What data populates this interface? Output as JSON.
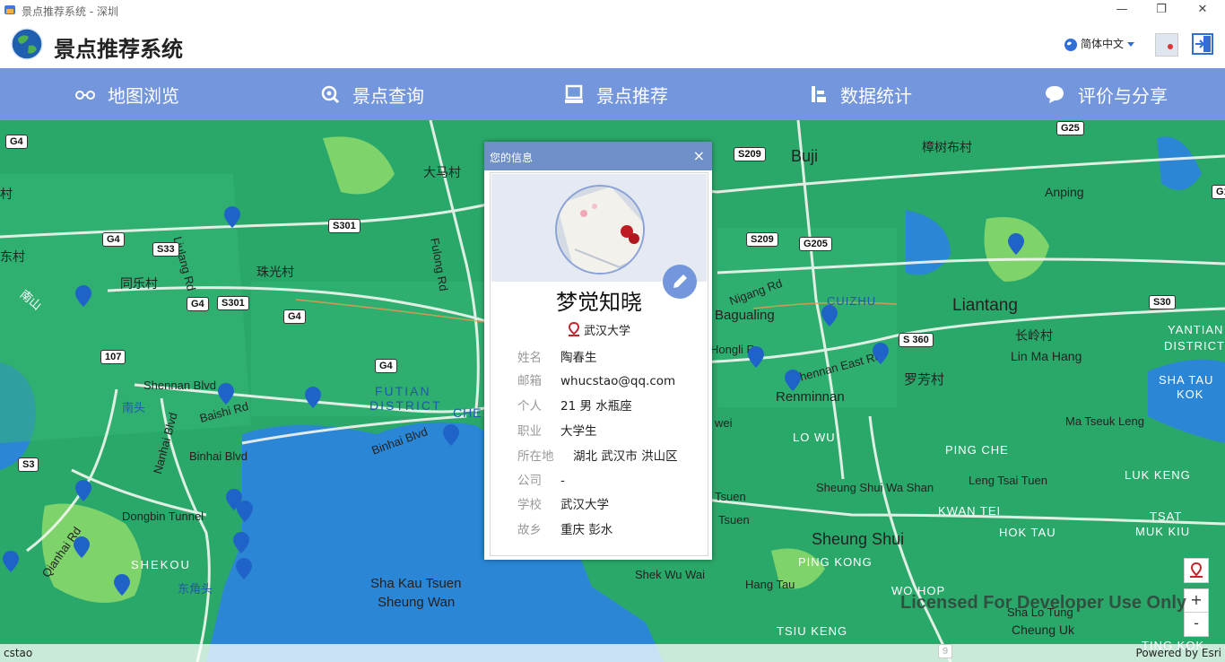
{
  "window": {
    "title": "景点推荐系统 - 深圳",
    "minimize": "—",
    "maximize": "❐",
    "close": "✕"
  },
  "header": {
    "app_title": "景点推荐系统",
    "language": "简体中文"
  },
  "nav": {
    "items": [
      {
        "label": "地图浏览",
        "icon": "glasses-icon"
      },
      {
        "label": "景点查询",
        "icon": "search-icon"
      },
      {
        "label": "景点推荐",
        "icon": "monitor-icon"
      },
      {
        "label": "数据统计",
        "icon": "chart-icon"
      },
      {
        "label": "评价与分享",
        "icon": "talk-icon"
      }
    ]
  },
  "map": {
    "labels": {
      "dama": "大马村",
      "buji": "Buji",
      "zhangshubu": "樟树布村",
      "anping": "Anping",
      "zhuguang": "珠光村",
      "tongle": "同乐村",
      "dongcun": "东村",
      "fulong": "Fulong Rd",
      "bagualing": "Bagualing",
      "niganglu": "Nigang Rd",
      "cuizhu": "CUIZHU",
      "liantang": "Liantang",
      "changling": "长岭村",
      "linmahang": "Lin Ma Hang",
      "yantian": "YANTIAN",
      "district": "DISTRICT",
      "shataukok": "SHA TAU",
      "kok": "KOK",
      "shennan_blvd": "Shennan Blvd",
      "nantou": "南头",
      "baishi": "Baishi Rd",
      "futian": "FUTIAN",
      "futian_district": "DISTRICT",
      "binhai": "Binhai Blvd",
      "binhai2": "Binhai Blvd",
      "nanhai": "Nanhai Blvd",
      "renminnan": "Renminnan",
      "shennan_east": "Shennan East Rd",
      "luofang": "罗芳村",
      "luowu": "LO WU",
      "pingche": "PING CHE",
      "matseuk": "Ma Tseuk Leng",
      "sheungshuiwashan": "Sheung Shui Wa Shan",
      "lengtsai": "Leng Tsai Tuen",
      "lukkeng": "LUK KENG",
      "kwantei": "KWAN TEI",
      "hoktau": "HOK TAU",
      "tsat": "TSAT",
      "mukkiu": "MUK KIU",
      "sheungshui": "Sheung Shui",
      "pingkong": "PING KONG",
      "wohop": "WO HOP",
      "hangtau": "Hang Tau",
      "shalotung": "Sha Lo Tung",
      "cheunguk": "Cheung Uk",
      "tsiukeng": "TSIU KENG",
      "tingkok": "TING KOK",
      "dongbin": "Dongbin Tunnel",
      "shekou": "SHEKOU",
      "dongjiaotou": "东角头",
      "qianhai": "Qianhai Rd",
      "shakau": "Sha Kau Tsuen",
      "sheungwan": "Sheung Wan",
      "shekwuwai": "Shek Wu Wai",
      "tsuen1": "Tsuen",
      "tsuen2": "Tsuen",
      "lilang": "Liulang Rd",
      "honglir": "Hongli R",
      "wei": "wei",
      "che": "CHE",
      "cun": "村",
      "nanshan": "南山"
    },
    "shields": [
      "G4",
      "S301",
      "G4",
      "S33",
      "G4",
      "S301",
      "G4",
      "107",
      "G4",
      "S3",
      "S209",
      "S209",
      "G205",
      "G25",
      "S30",
      "S 360",
      "G1",
      "9"
    ],
    "controls": {
      "zoom_in": "+",
      "zoom_out": "-"
    },
    "watermark": "Licensed For Developer Use Only",
    "footer_left": "cstao",
    "footer_right": "Powered by Esri"
  },
  "dialog": {
    "title": "您的信息",
    "close": "×",
    "nickname": "梦觉知晓",
    "school_tag": "武汉大学",
    "rows": [
      {
        "k": "姓名",
        "v": "陶春生"
      },
      {
        "k": "邮箱",
        "v": "whucstao@qq.com"
      },
      {
        "k": "个人",
        "v": "21 男 水瓶座"
      },
      {
        "k": "职业",
        "v": "大学生"
      },
      {
        "k": "所在地",
        "v": "湖北 武汉市 洪山区"
      },
      {
        "k": "公司",
        "v": "-"
      },
      {
        "k": "学校",
        "v": "武汉大学"
      },
      {
        "k": "故乡",
        "v": "重庆 彭水"
      }
    ]
  },
  "colors": {
    "nav": "#7396dc",
    "map_land": "#2aa86a",
    "water": "#2b86d6",
    "pin": "#1f63c9"
  }
}
